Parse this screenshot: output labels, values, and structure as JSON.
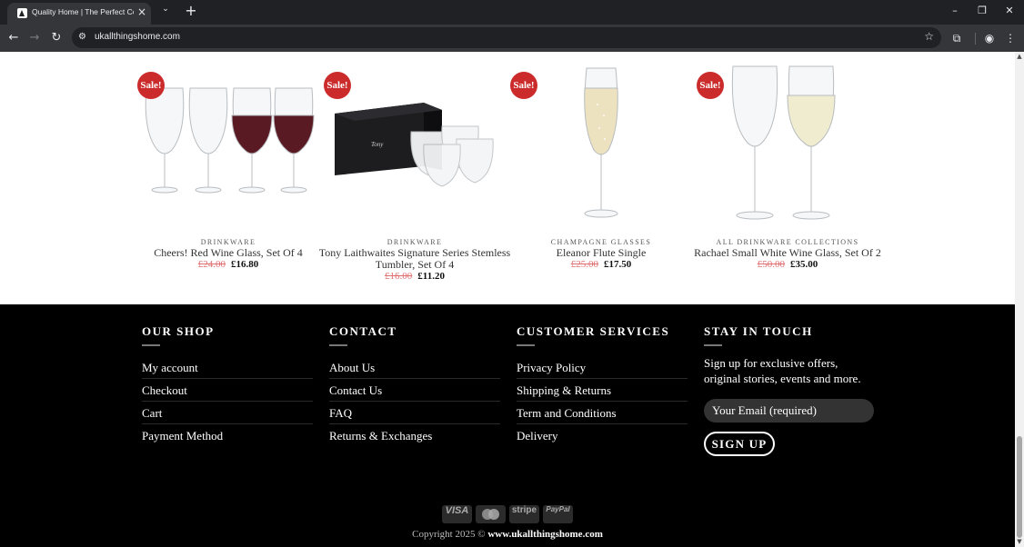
{
  "browser": {
    "tab_title": "Quality Home | The Perfect Co",
    "url": "ukallthingshome.com"
  },
  "products": [
    {
      "sale_label": "Sale!",
      "category": "DRINKWARE",
      "name": "Cheers! Red Wine Glass, Set Of 4",
      "old_price": "£24.00",
      "new_price": "£16.80"
    },
    {
      "sale_label": "Sale!",
      "category": "DRINKWARE",
      "name": "Tony Laithwaites Signature Series Stemless Tumbler, Set Of 4",
      "old_price": "£16.00",
      "new_price": "£11.20"
    },
    {
      "sale_label": "Sale!",
      "category": "CHAMPAGNE GLASSES",
      "name": "Eleanor Flute Single",
      "old_price": "£25.00",
      "new_price": "£17.50"
    },
    {
      "sale_label": "Sale!",
      "category": "ALL DRINKWARE COLLECTIONS",
      "name": "Rachael Small White Wine Glass, Set Of 2",
      "old_price": "£50.00",
      "new_price": "£35.00"
    }
  ],
  "footer": {
    "shop": {
      "title": "OUR SHOP",
      "links": [
        "My account",
        "Checkout",
        "Cart",
        "Payment Method"
      ]
    },
    "contact": {
      "title": "CONTACT",
      "links": [
        "About Us",
        "Contact Us",
        "FAQ",
        "Returns & Exchanges"
      ]
    },
    "services": {
      "title": "CUSTOMER SERVICES",
      "links": [
        "Privacy Policy",
        "Shipping & Returns",
        "Term and Conditions",
        "Delivery"
      ]
    },
    "touch": {
      "title": "STAY IN TOUCH",
      "text": "Sign up for exclusive offers, original stories, events and more.",
      "email_placeholder": "Your Email (required)",
      "button": "SIGN UP"
    },
    "payments": [
      "VISA",
      "mastercard",
      "stripe",
      "PayPal"
    ],
    "copyright_prefix": "Copyright 2025 © ",
    "copyright_site": "www.ukallthingshome.com"
  }
}
